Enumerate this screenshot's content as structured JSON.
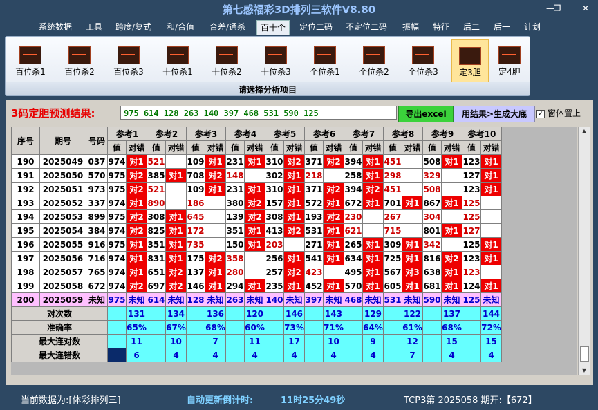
{
  "app": {
    "title": "第七感福彩3D排列三软件V8.80"
  },
  "window": {
    "minimize": "—",
    "restore": "❐",
    "close": "✕"
  },
  "menu": [
    "系统数据",
    "工具",
    "跨度/复式",
    "和/合值",
    "合差/通杀",
    "百十个",
    "定位二码",
    "不定位二码",
    "振幅",
    "特征",
    "后二",
    "后一",
    "计划"
  ],
  "ribbon": {
    "buttons": [
      "百位杀1",
      "百位杀2",
      "百位杀3",
      "十位杀1",
      "十位杀2",
      "十位杀3",
      "个位杀1",
      "个位杀2",
      "个位杀3",
      "定3胆",
      "定4胆"
    ],
    "caption": "请选择分析项目"
  },
  "result": {
    "label": "3码定胆预测结果:",
    "value": "975 614 128 263 140 397 468 531 590 125",
    "export_label": "导出excel",
    "generate_label": "用结果>生成大底",
    "ontop_label": "窗体置上",
    "ontop_checked": "✓"
  },
  "table": {
    "head": {
      "seq": "序号",
      "period": "期号",
      "number": "号码",
      "val": "值",
      "hit": "对错",
      "refs": [
        "参考1",
        "参考2",
        "参考3",
        "参考4",
        "参考5",
        "参考6",
        "参考7",
        "参考8",
        "参考9",
        "参考10"
      ]
    },
    "rows": [
      {
        "seq": "190",
        "period": "2025049",
        "num": "037",
        "cells": [
          [
            "974",
            "对1"
          ],
          [
            "521",
            ""
          ],
          [
            "109",
            "对1"
          ],
          [
            "231",
            "对1"
          ],
          [
            "310",
            "对2"
          ],
          [
            "371",
            "对2"
          ],
          [
            "394",
            "对1"
          ],
          [
            "451",
            ""
          ],
          [
            "508",
            "对1"
          ],
          [
            "123",
            "对1"
          ]
        ]
      },
      {
        "seq": "191",
        "period": "2025050",
        "num": "570",
        "cells": [
          [
            "975",
            "对2"
          ],
          [
            "385",
            "对1"
          ],
          [
            "708",
            "对2"
          ],
          [
            "148",
            ""
          ],
          [
            "302",
            "对1"
          ],
          [
            "218",
            ""
          ],
          [
            "258",
            "对1"
          ],
          [
            "298",
            ""
          ],
          [
            "329",
            ""
          ],
          [
            "127",
            "对1"
          ]
        ]
      },
      {
        "seq": "192",
        "period": "2025051",
        "num": "973",
        "cells": [
          [
            "975",
            "对2"
          ],
          [
            "521",
            ""
          ],
          [
            "109",
            "对1"
          ],
          [
            "231",
            "对1"
          ],
          [
            "310",
            "对1"
          ],
          [
            "371",
            "对2"
          ],
          [
            "394",
            "对2"
          ],
          [
            "451",
            ""
          ],
          [
            "508",
            ""
          ],
          [
            "123",
            "对1"
          ]
        ]
      },
      {
        "seq": "193",
        "period": "2025052",
        "num": "337",
        "cells": [
          [
            "974",
            "对1"
          ],
          [
            "890",
            ""
          ],
          [
            "186",
            ""
          ],
          [
            "380",
            "对2"
          ],
          [
            "157",
            "对1"
          ],
          [
            "572",
            "对1"
          ],
          [
            "672",
            "对1"
          ],
          [
            "701",
            "对1"
          ],
          [
            "867",
            "对1"
          ],
          [
            "125",
            ""
          ]
        ]
      },
      {
        "seq": "194",
        "period": "2025053",
        "num": "899",
        "cells": [
          [
            "975",
            "对2"
          ],
          [
            "308",
            "对1"
          ],
          [
            "645",
            ""
          ],
          [
            "139",
            "对2"
          ],
          [
            "308",
            "对1"
          ],
          [
            "193",
            "对2"
          ],
          [
            "230",
            ""
          ],
          [
            "267",
            ""
          ],
          [
            "304",
            ""
          ],
          [
            "125",
            ""
          ]
        ]
      },
      {
        "seq": "195",
        "period": "2025054",
        "num": "384",
        "cells": [
          [
            "974",
            "对2"
          ],
          [
            "825",
            "对1"
          ],
          [
            "172",
            ""
          ],
          [
            "351",
            "对1"
          ],
          [
            "413",
            "对2"
          ],
          [
            "531",
            "对1"
          ],
          [
            "621",
            ""
          ],
          [
            "715",
            ""
          ],
          [
            "801",
            "对1"
          ],
          [
            "127",
            ""
          ]
        ]
      },
      {
        "seq": "196",
        "period": "2025055",
        "num": "916",
        "cells": [
          [
            "975",
            "对1"
          ],
          [
            "351",
            "对1"
          ],
          [
            "735",
            ""
          ],
          [
            "150",
            "对1"
          ],
          [
            "203",
            ""
          ],
          [
            "271",
            "对1"
          ],
          [
            "265",
            "对1"
          ],
          [
            "309",
            "对1"
          ],
          [
            "342",
            ""
          ],
          [
            "125",
            "对1"
          ]
        ]
      },
      {
        "seq": "197",
        "period": "2025056",
        "num": "716",
        "cells": [
          [
            "974",
            "对1"
          ],
          [
            "831",
            "对1"
          ],
          [
            "175",
            "对2"
          ],
          [
            "358",
            ""
          ],
          [
            "256",
            "对1"
          ],
          [
            "541",
            "对1"
          ],
          [
            "634",
            "对1"
          ],
          [
            "725",
            "对1"
          ],
          [
            "816",
            "对2"
          ],
          [
            "123",
            "对1"
          ]
        ]
      },
      {
        "seq": "198",
        "period": "2025057",
        "num": "765",
        "cells": [
          [
            "974",
            "对1"
          ],
          [
            "651",
            "对2"
          ],
          [
            "137",
            "对1"
          ],
          [
            "280",
            ""
          ],
          [
            "257",
            "对2"
          ],
          [
            "423",
            ""
          ],
          [
            "495",
            "对1"
          ],
          [
            "567",
            "对3"
          ],
          [
            "638",
            "对1"
          ],
          [
            "123",
            ""
          ]
        ]
      },
      {
        "seq": "199",
        "period": "2025058",
        "num": "672",
        "cells": [
          [
            "974",
            "对2"
          ],
          [
            "697",
            "对2"
          ],
          [
            "146",
            "对1"
          ],
          [
            "294",
            "对1"
          ],
          [
            "235",
            "对1"
          ],
          [
            "452",
            "对1"
          ],
          [
            "570",
            "对1"
          ],
          [
            "605",
            "对1"
          ],
          [
            "681",
            "对1"
          ],
          [
            "124",
            "对1"
          ]
        ]
      }
    ],
    "future": {
      "seq": "200",
      "period": "2025059",
      "num": "未知",
      "cells": [
        [
          "975",
          "未知"
        ],
        [
          "614",
          "未知"
        ],
        [
          "128",
          "未知"
        ],
        [
          "263",
          "未知"
        ],
        [
          "140",
          "未知"
        ],
        [
          "397",
          "未知"
        ],
        [
          "468",
          "未知"
        ],
        [
          "531",
          "未知"
        ],
        [
          "590",
          "未知"
        ],
        [
          "125",
          "未知"
        ]
      ]
    },
    "stats": [
      {
        "label": "对次数",
        "values": [
          "131",
          "134",
          "136",
          "120",
          "146",
          "143",
          "129",
          "122",
          "137",
          "144"
        ]
      },
      {
        "label": "准确率",
        "values": [
          "65%",
          "67%",
          "68%",
          "60%",
          "73%",
          "71%",
          "64%",
          "61%",
          "68%",
          "72%"
        ]
      },
      {
        "label": "最大连对数",
        "values": [
          "11",
          "10",
          "7",
          "11",
          "17",
          "10",
          "9",
          "12",
          "15",
          "15"
        ]
      },
      {
        "label": "最大连错数",
        "values": [
          "6",
          "4",
          "4",
          "4",
          "4",
          "4",
          "4",
          "7",
          "4",
          "4"
        ]
      }
    ]
  },
  "status": {
    "current_label": "当前数据为:[体彩排列三]",
    "countdown_label": "自动更新倒计时: ",
    "countdown_value": "11时25分49秒",
    "draw_label": "TCP3第 2025058 期开:【672】"
  },
  "colors": {
    "hit": "#ee0000",
    "future": "#ffc0ff",
    "stats": "#66ffff",
    "background": "#2d4863"
  }
}
